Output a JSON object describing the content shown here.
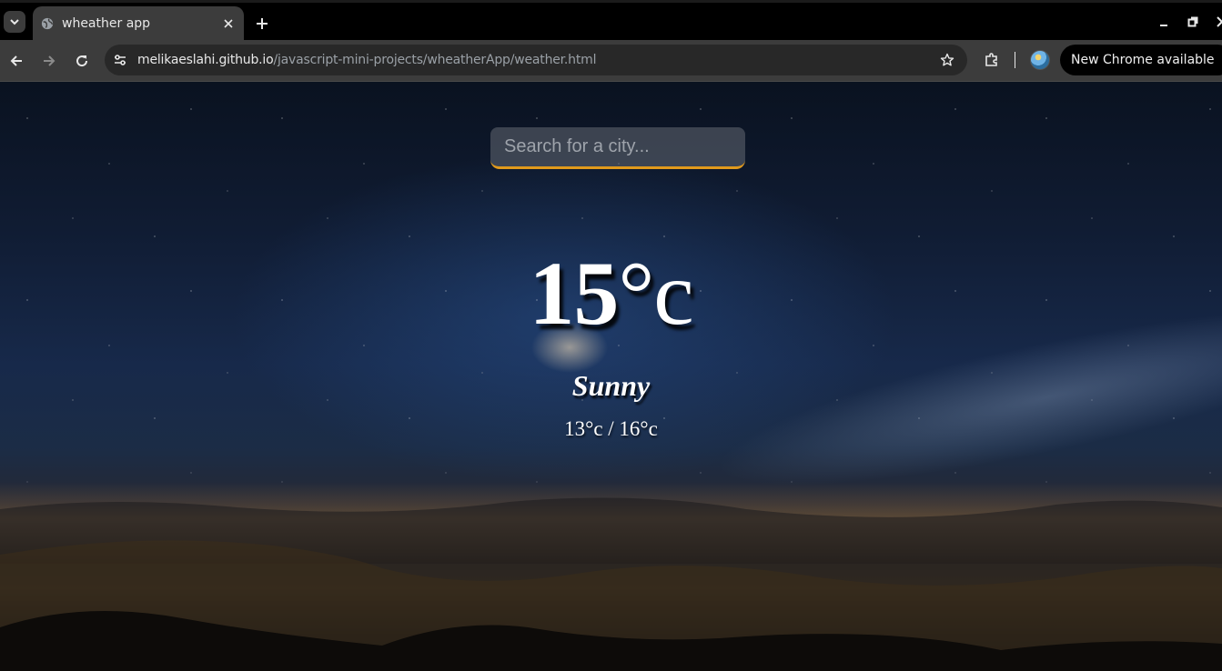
{
  "browser": {
    "tab_title": "wheather app",
    "url_host": "melikaeslahi.github.io",
    "url_path": "/javascript-mini-projects/wheatherApp/weather.html",
    "update_chip": "New Chrome available"
  },
  "icons": {
    "tab_search": "chevron-down-icon",
    "tab_favicon": "globe-icon",
    "tab_close": "close-icon",
    "new_tab": "plus-icon",
    "back": "back-arrow-icon",
    "forward": "forward-arrow-icon",
    "reload": "reload-icon",
    "site_info": "tune-icon",
    "bookmark": "star-icon",
    "extensions": "puzzle-icon",
    "minimize": "minimize-icon",
    "restore": "restore-icon",
    "close_window": "close-icon"
  },
  "weather": {
    "search_placeholder": "Search for a city...",
    "temp_value": "15",
    "temp_unit": "°c",
    "condition": "Sunny",
    "range": "13°c / 16°c"
  },
  "colors": {
    "search_underline": "#e19a1c",
    "chrome_toolbar": "#3c3c3c"
  }
}
